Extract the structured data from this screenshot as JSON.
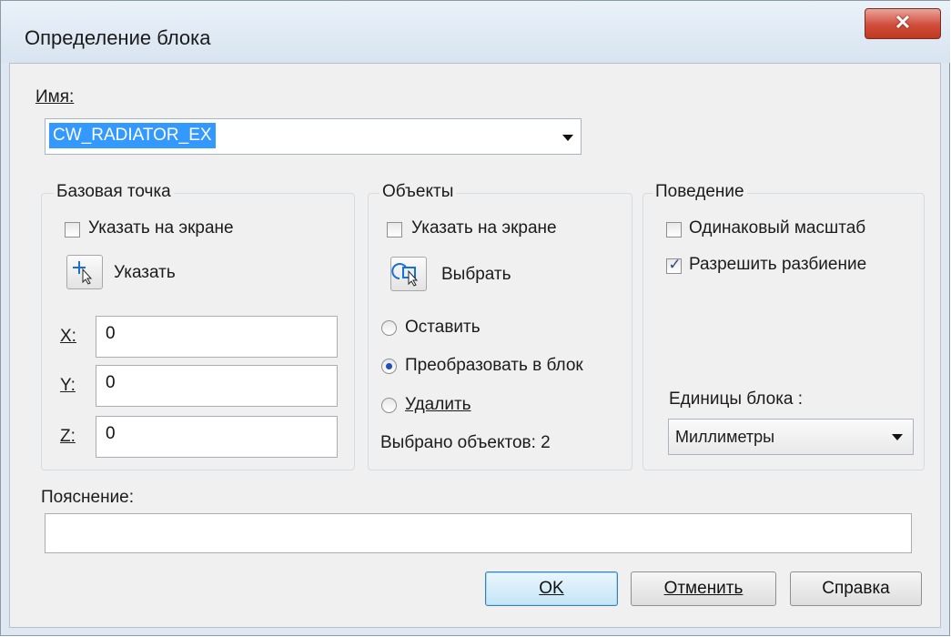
{
  "dialog": {
    "title": "Определение блока",
    "close_glyph": "✕"
  },
  "name": {
    "label": "Имя:",
    "value": "CW_RADIATOR_EX"
  },
  "base_point": {
    "title": "Базовая точка",
    "specify_on_screen": "Указать на экране",
    "specify_on_screen_checked": false,
    "pick_label": "Указать",
    "x_label": "X:",
    "x_value": "0",
    "y_label": "Y:",
    "y_value": "0",
    "z_label": "Z:",
    "z_value": "0"
  },
  "objects": {
    "title": "Объекты",
    "specify_on_screen": "Указать на экране",
    "specify_on_screen_checked": false,
    "select_label": "Выбрать",
    "options": [
      "Оставить",
      "Преобразовать в блок",
      "Удалить"
    ],
    "selected_option": "Преобразовать в блок",
    "selected_count_text": "Выбрано объектов: 2"
  },
  "behavior": {
    "title": "Поведение",
    "uniform_scale": "Одинаковый масштаб",
    "uniform_scale_checked": false,
    "allow_explode": "Разрешить разбиение",
    "allow_explode_checked": true,
    "units_label": "Единицы блока :",
    "units_value": "Миллиметры"
  },
  "description": {
    "label": "Пояснение:",
    "value": ""
  },
  "buttons": {
    "ok": "OK",
    "cancel": "Отменить",
    "help": "Справка"
  }
}
